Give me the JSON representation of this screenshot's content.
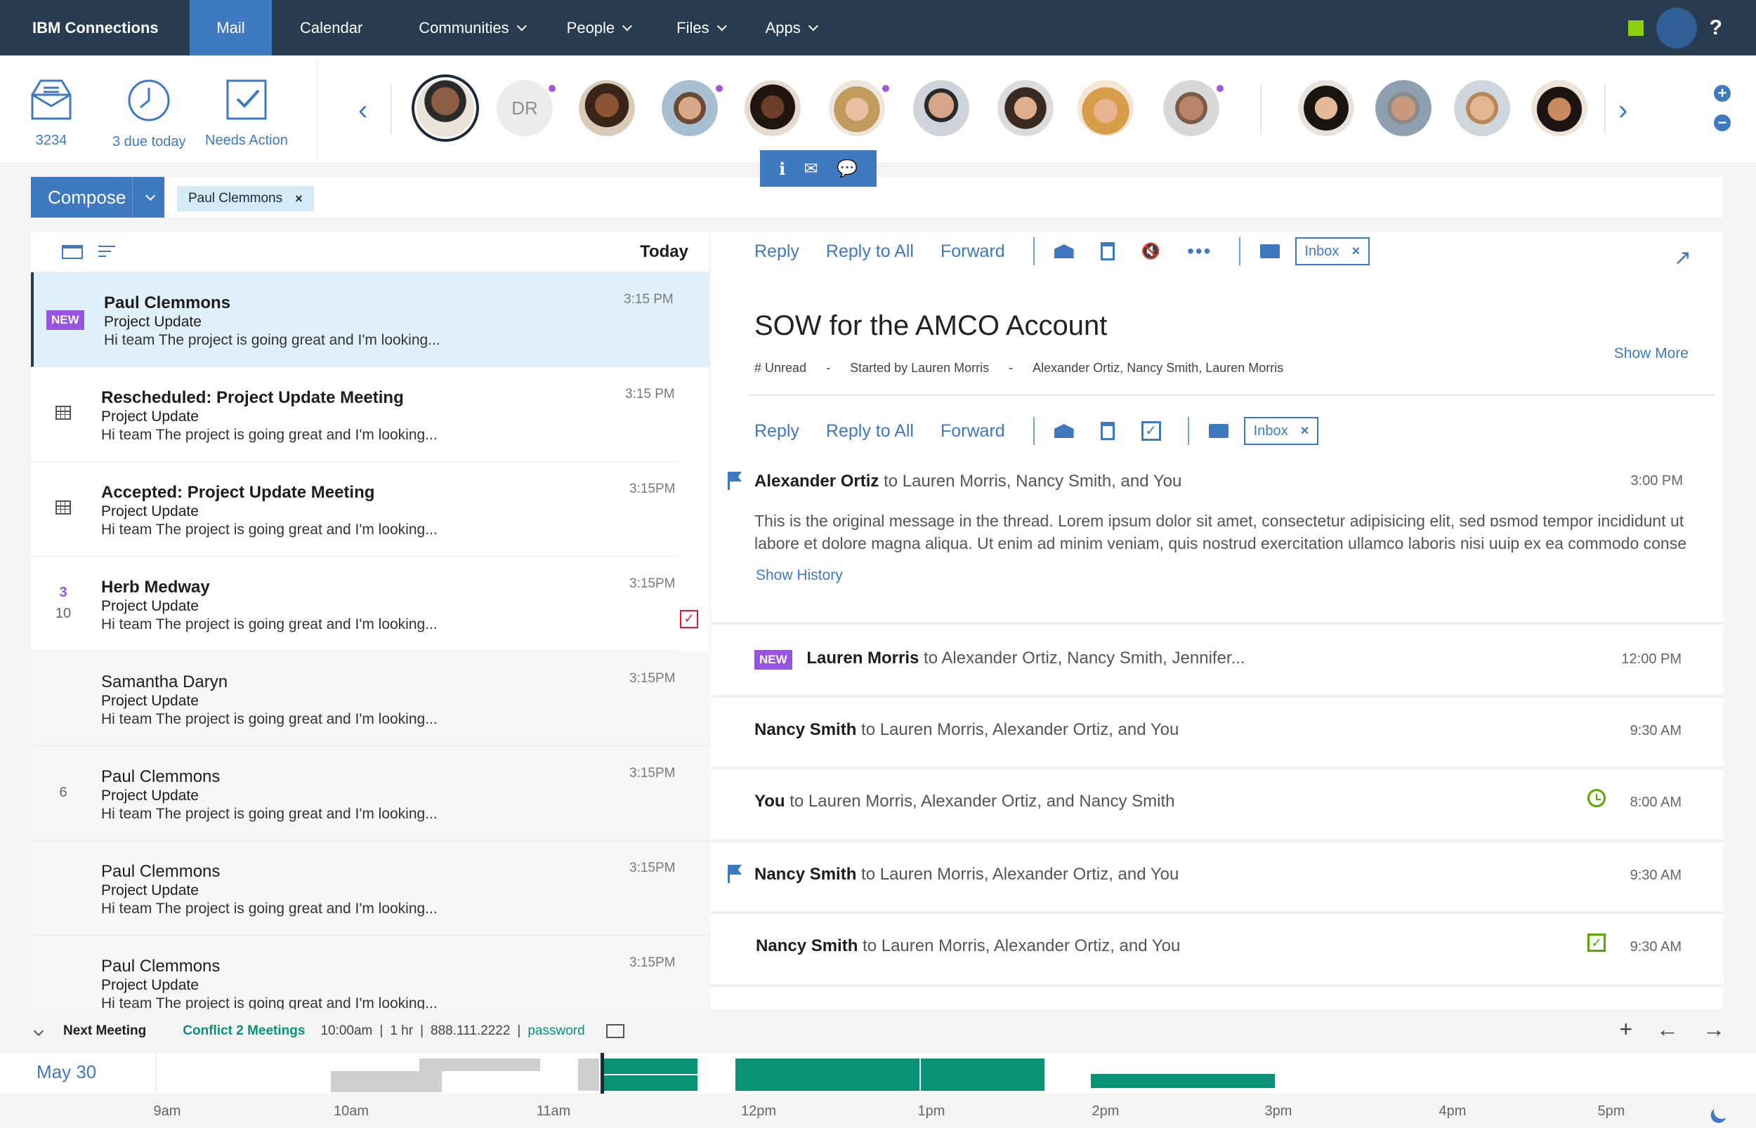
{
  "nav": {
    "brand": "IBM Connections",
    "items": [
      {
        "label": "Mail",
        "active": true
      },
      {
        "label": "Calendar"
      },
      {
        "label": "Communities",
        "dropdown": true
      },
      {
        "label": "People",
        "dropdown": true
      },
      {
        "label": "Files",
        "dropdown": true
      },
      {
        "label": "Apps",
        "dropdown": true
      }
    ],
    "help": "?"
  },
  "quick": {
    "inbox_count": "3234",
    "due_label": "3 due today",
    "action_label": "Needs Action"
  },
  "people": {
    "initials_avatar": "DR",
    "hover_actions": [
      "info-icon",
      "mail-icon",
      "chat-icon"
    ]
  },
  "compose": {
    "label": "Compose",
    "filter_chip": "Paul Clemmons",
    "chip_close": "×"
  },
  "list": {
    "header": "Today",
    "rows": [
      {
        "from": "Paul Clemmons",
        "subject": "Project Update",
        "snippet": "Hi team The project is going great and I'm looking...",
        "time": "3:15 PM",
        "badge": "NEW"
      },
      {
        "from": "Rescheduled: Project Update Meeting",
        "subject": "Project Update",
        "snippet": "Hi team The project is going great and I'm looking...",
        "time": "3:15 PM"
      },
      {
        "from": "Accepted: Project Update Meeting",
        "subject": "Project Update",
        "snippet": "Hi team The project is going great and I'm looking...",
        "time": "3:15PM"
      },
      {
        "from": "Herb Medway",
        "subject": "Project Update",
        "snippet": "Hi team The project is going great and I'm looking...",
        "time": "3:15PM",
        "count_top": "3",
        "count_bottom": "10"
      },
      {
        "from": "Samantha Daryn",
        "subject": "Project Update",
        "snippet": "Hi team The project is going great and I'm looking...",
        "time": "3:15PM"
      },
      {
        "from": "Paul Clemmons",
        "subject": "Project Update",
        "snippet": "Hi team The project is going great and I'm looking...",
        "time": "3:15PM",
        "count": "6"
      },
      {
        "from": "Paul Clemmons",
        "subject": "Project Update",
        "snippet": "Hi team The project is going great and I'm looking...",
        "time": "3:15PM"
      },
      {
        "from": "Paul Clemmons",
        "subject": "Project Update",
        "snippet": "Hi team The project is going great and I'm looking...",
        "time": "3:15PM"
      }
    ]
  },
  "reader": {
    "actions": {
      "reply": "Reply",
      "reply_all": "Reply to All",
      "forward": "Forward",
      "folder_chip": "Inbox",
      "chip_close": "×"
    },
    "title": "SOW for the AMCO Account",
    "meta": [
      "# Unread",
      "-",
      "Started by Lauren Morris",
      "-",
      "Alexander Ortiz, Nancy Smith, Lauren Morris"
    ],
    "show_more": "Show More",
    "first_message": {
      "sender": "Alexander Ortiz",
      "recipients": "to Lauren Morris, Nancy Smith, and You",
      "time": "3:00 PM",
      "body": "This is the original message in the thread. Lorem ipsum dolor sit amet, consectetur adipisicing elit, sed ɒsmod tempor incididunt ut labore et dolore magna aliqua. Ut enim ad minim veniam, quis nostrud exercitation ullamco laboris nisi uuip ex ea commodo conse",
      "show_history": "Show History"
    },
    "messages": [
      {
        "badge": "NEW",
        "sender": "Lauren Morris",
        "recipients": "to Alexander Ortiz, Nancy Smith, Jennifer...",
        "time": "12:00 PM"
      },
      {
        "sender": "Nancy Smith",
        "recipients": "to Lauren Morris, Alexander Ortiz, and You",
        "time": "9:30 AM"
      },
      {
        "sender": "You",
        "recipients": "to Lauren Morris, Alexander Ortiz, and Nancy Smith",
        "time": "8:00 AM"
      },
      {
        "sender": "Nancy Smith",
        "recipients": "to Lauren Morris, Alexander Ortiz, and You",
        "time": "9:30 AM"
      },
      {
        "sender": "Nancy Smith",
        "recipients": "to Lauren Morris, Alexander Ortiz, and You",
        "time": "9:30 AM"
      }
    ]
  },
  "meeting": {
    "next_label": "Next Meeting",
    "conflict": "Conflict 2 Meetings",
    "time": "10:00am",
    "duration": "1 hr",
    "phone": "888.111.2222",
    "password": "password",
    "sep": "|"
  },
  "timeline": {
    "date": "May 30",
    "ticks": [
      "9am",
      "10am",
      "11am",
      "12pm",
      "1pm",
      "2pm",
      "3pm",
      "4pm",
      "5pm"
    ]
  },
  "colors": {
    "nav_bg": "#283c4f",
    "accent": "#3f7ac1",
    "new_badge": "#9753e1",
    "meeting_teal": "#0a9276"
  }
}
